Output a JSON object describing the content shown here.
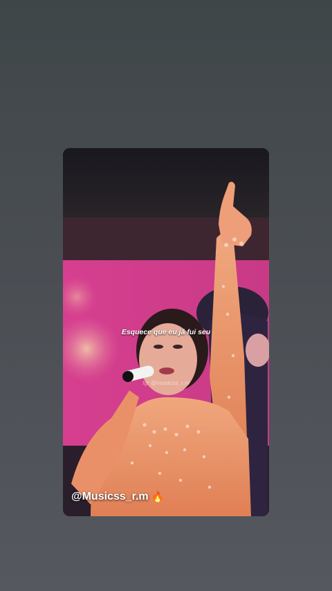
{
  "story": {
    "caption": "Esquece que eu já fui seu",
    "watermark": "Ig: @musicss_r.m",
    "handle": "@Musicss_r.m",
    "handle_emoji": "🔥"
  },
  "colors": {
    "background": "#474b50",
    "stage_pink": "#d13f8c",
    "outfit": "#e88a62"
  }
}
